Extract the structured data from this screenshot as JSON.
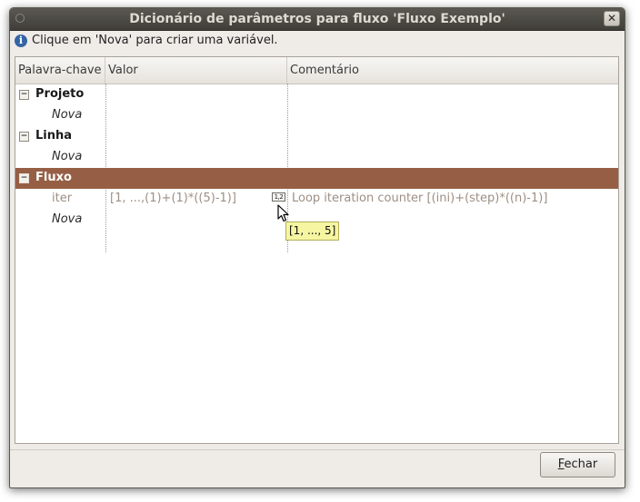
{
  "window": {
    "title": "Dicionário de parâmetros para fluxo 'Fluxo Exemplo'",
    "close_glyph": "✕",
    "menu_icon": "window-menu-icon"
  },
  "info": {
    "icon": "info-icon",
    "icon_glyph": "i",
    "text": "Clique em 'Nova' para criar uma variável."
  },
  "table": {
    "columns": [
      "Palavra-chave",
      "Valor",
      "Comentário"
    ],
    "groups": [
      {
        "label": "Projeto",
        "expander": "−",
        "children": [
          {
            "key": "Nova",
            "value": "",
            "comment": ""
          }
        ]
      },
      {
        "label": "Linha",
        "expander": "−",
        "children": [
          {
            "key": "Nova",
            "value": "",
            "comment": ""
          }
        ]
      },
      {
        "label": "Fluxo",
        "expander": "−",
        "selected": true,
        "children": [
          {
            "key": "iter",
            "value": "[1, ...,(1)+(1)*((5)-1)]",
            "comment": "Loop iteration counter [(ini)+(step)*((n)-1)]",
            "icon_text": "1,2"
          },
          {
            "key": "Nova",
            "value": "",
            "comment": ""
          }
        ]
      }
    ]
  },
  "tooltip": {
    "text": "[1, ..., 5]"
  },
  "footer": {
    "close_mnemonic": "F",
    "close_rest": "echar"
  },
  "colors": {
    "selection": "#965f45",
    "tooltip_bg": "#f6f5a2",
    "muted_text": "#9e8f84"
  }
}
